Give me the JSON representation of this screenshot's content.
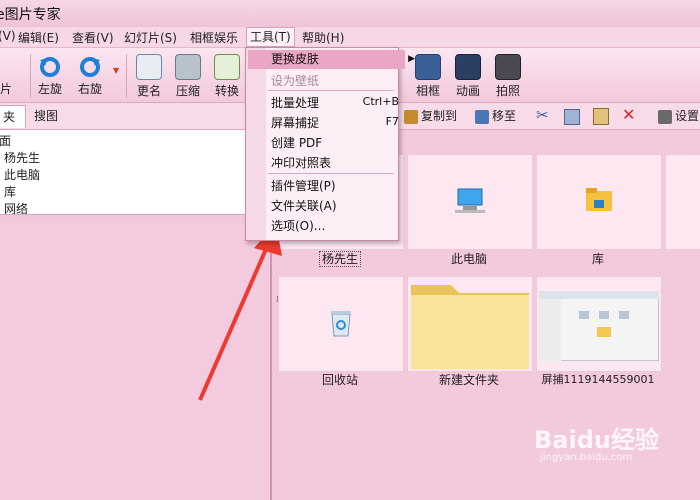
{
  "window": {
    "title": "e图片专家"
  },
  "menu": [
    "(V)",
    "编辑(E)",
    "查看(V)",
    "幻灯片(S)",
    "相框娱乐",
    "工具(T)",
    "帮助(H)"
  ],
  "toolbar": {
    "left_partial": "片",
    "items": [
      "左旋",
      "右旋",
      "更名",
      "压缩",
      "转换",
      "相框",
      "动画",
      "拍照"
    ]
  },
  "tabs": [
    "夹",
    "搜图"
  ],
  "toolbar2": {
    "copy_to": "复制到",
    "move_to": "移至",
    "settings": "设置"
  },
  "tree": [
    "面",
    "杨先生",
    "此电脑",
    "库",
    "网络"
  ],
  "dropdown": {
    "items": [
      {
        "label": "更换皮肤",
        "has_submenu": true,
        "highlighted": true
      },
      {
        "label": "设为壁纸",
        "disabled": true
      },
      {
        "label": "批量处理",
        "shortcut": "Ctrl+B"
      },
      {
        "label": "屏幕捕捉",
        "shortcut": "F7"
      },
      {
        "label": "创建 PDF"
      },
      {
        "label": "冲印对照表"
      },
      {
        "label": "插件管理(P)"
      },
      {
        "label": "文件关联(A)"
      },
      {
        "label": "选项(O)..."
      }
    ]
  },
  "thumbs": [
    {
      "caption": "杨先生"
    },
    {
      "caption": "此电脑"
    },
    {
      "caption": "库"
    },
    {
      "caption": "回收站"
    },
    {
      "caption": "新建文件夹"
    },
    {
      "caption": "屏捕1119144559001"
    }
  ],
  "watermark": {
    "text": "Baidu经验",
    "url": "jingyan.baidu.com"
  },
  "colors": {
    "accent": "#e9a7c5",
    "arrow": "#ee3a2e",
    "background": "#f3c9dc"
  }
}
